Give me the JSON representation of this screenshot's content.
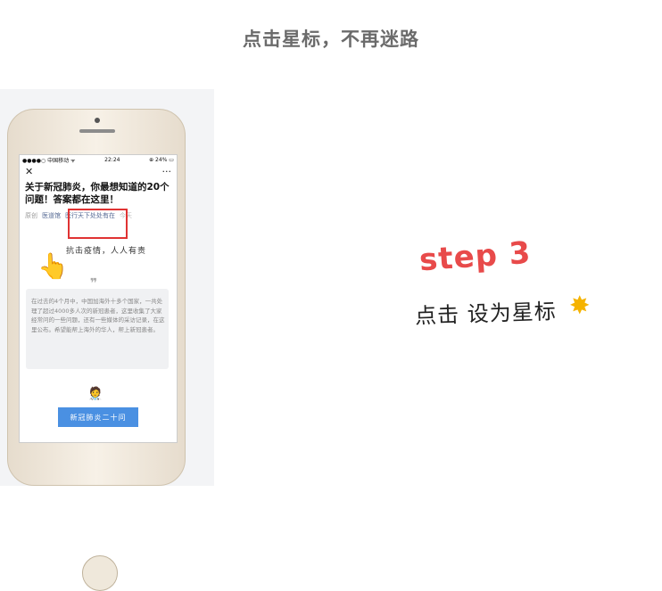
{
  "headline": "点击星标，不再迷路",
  "phone": {
    "status_carrier": "●●●●○ 中国移动 ᯤ",
    "status_time": "22:24",
    "status_battery": "⊕ 24% ▭",
    "nav_close": "✕",
    "nav_more": "···",
    "article_title": "关于新冠肺炎，你最想知道的20个问题！答案都在这里！",
    "meta_tag": "原创",
    "meta_author": "医道馆",
    "meta_account": "医行天下处处有在",
    "meta_date": "今天",
    "slogan": "抗击疫情，人人有责",
    "quote_mark": "❞",
    "card_text": "在过去的4个月中，中国加海外十多个国家，一共处理了超过4000多人次的新冠患者，这里收集了大家经常问的一些问题，还有一些媒体的采访记录，在这里公布。希望能帮上海外的华人，帮上新冠患者。",
    "cta_label": "新冠肺炎二十问"
  },
  "step_label": "step 3",
  "instruction": "点击 设为星标",
  "icons": {
    "hand": "pointing-hand-icon",
    "sparkle": "star-sparkle-icon",
    "doctor": "doctor-icon"
  },
  "colors": {
    "step": "#e84a4a",
    "highlight_box": "#e03333",
    "cta": "#4a90e2",
    "link": "#576b95"
  }
}
